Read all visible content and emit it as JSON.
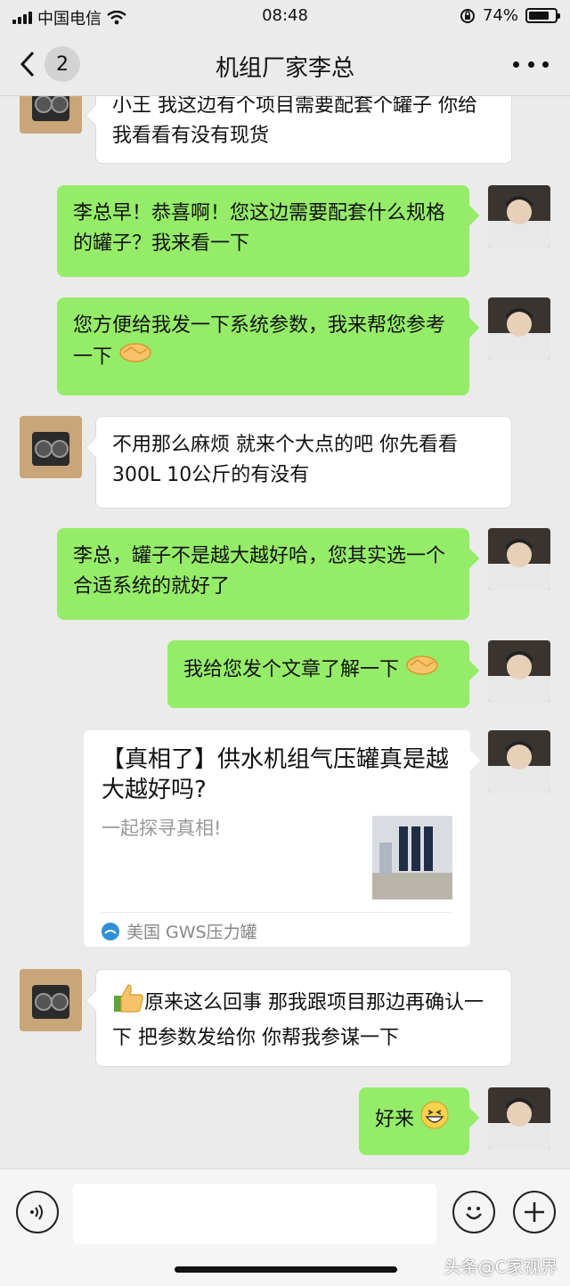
{
  "status_bar": {
    "carrier": "中国电信",
    "time": "08:48",
    "battery": "74%"
  },
  "nav": {
    "back_count": "2",
    "title": "机组厂家李总"
  },
  "messages": [
    {
      "side": "left",
      "text": "小王 我这边有个项目需要配套个罐子 你给我看看有没有现货"
    },
    {
      "side": "right",
      "text": "李总早！恭喜啊！您这边需要配套什么规格的罐子？我来看一下"
    },
    {
      "side": "right",
      "text": "您方便给我发一下系统参数，我来帮您参考一下",
      "emoji": "handshake-emoji"
    },
    {
      "side": "left",
      "text": "不用那么麻烦 就来个大点的吧 你先看看300L 10公斤的有没有"
    },
    {
      "side": "right",
      "text": "李总，罐子不是越大越好哈，您其实选一个合适系统的就好了"
    },
    {
      "side": "right",
      "text": "我给您发个文章了解一下",
      "emoji": "handshake-emoji"
    },
    {
      "side": "left",
      "text": "原来这么回事 那我跟项目那边再确认一下 把参数发给你 你帮我参谋一下",
      "emoji": "thumbs-up-emoji"
    },
    {
      "side": "right",
      "text": "好来",
      "emoji": "grin-emoji"
    }
  ],
  "article_card": {
    "title": "【真相了】供水机组气压罐真是越大越好吗?",
    "description": "一起探寻真相!",
    "source": "美国 GWS压力罐"
  },
  "bottom_bar": {
    "input_value": ""
  },
  "watermark": "头条@C家视界",
  "colors": {
    "self_bubble": "#95ec69",
    "other_bubble": "#ffffff",
    "background": "#ebebeb"
  }
}
